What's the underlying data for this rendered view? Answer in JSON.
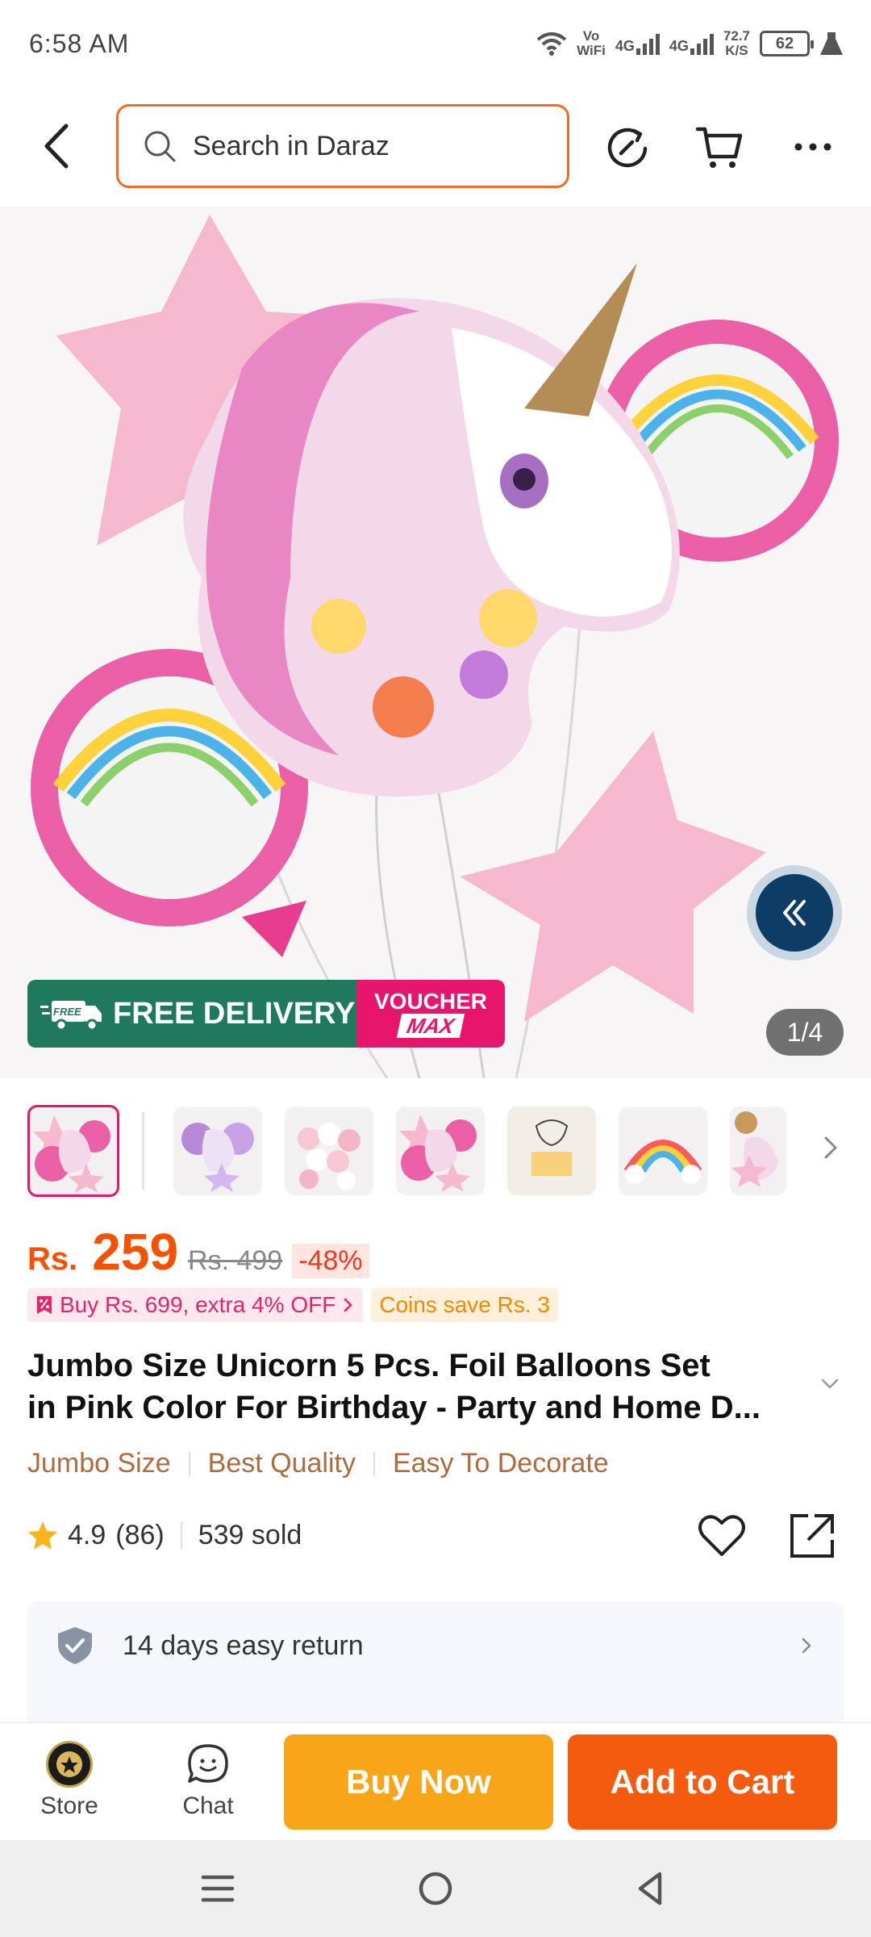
{
  "status_bar": {
    "time": "6:58 AM",
    "vowifi_top": "Vo",
    "vowifi_bottom": "WiFi",
    "net1": "4G",
    "net2": "4G",
    "speed_value": "72.7",
    "speed_unit": "K/S",
    "battery": "62"
  },
  "search": {
    "placeholder": "Search in Daraz"
  },
  "icons": {
    "back": "back-arrow-icon",
    "refresh": "refresh-icon",
    "cart": "cart-icon",
    "more": "more-icon"
  },
  "hero": {
    "free_delivery_badge": "FREE",
    "free_delivery": "FREE DELIVERY",
    "voucher_line1": "VOUCHER",
    "voucher_line2": "MAX",
    "page_counter": "1/4"
  },
  "price": {
    "currency": "Rs.",
    "current": "259",
    "original": "Rs. 499",
    "discount": "-48%"
  },
  "promotions": {
    "bundle": "Buy Rs. 699, extra 4% OFF",
    "coins": "Coins save Rs. 3"
  },
  "product": {
    "title_line1": "Jumbo Size Unicorn 5 Pcs.  Foil Balloons Set",
    "title_line2": "in Pink Color For Birthday - Party and Home D...",
    "tags": [
      "Jumbo Size",
      "Best Quality",
      "Easy To Decorate"
    ],
    "rating": "4.9",
    "reviews": "(86)",
    "sold": "539 sold"
  },
  "service": {
    "return_policy": "14 days easy return"
  },
  "action_bar": {
    "store_label": "Store",
    "chat_label": "Chat",
    "buy_now": "Buy Now",
    "add_to_cart": "Add to Cart"
  },
  "colors": {
    "brand_orange": "#f55b0e",
    "buy_now_yellow": "#f9a51a",
    "price_orange": "#f55200",
    "free_delivery_green": "#1f7a5d",
    "voucher_pink": "#e8156d"
  }
}
